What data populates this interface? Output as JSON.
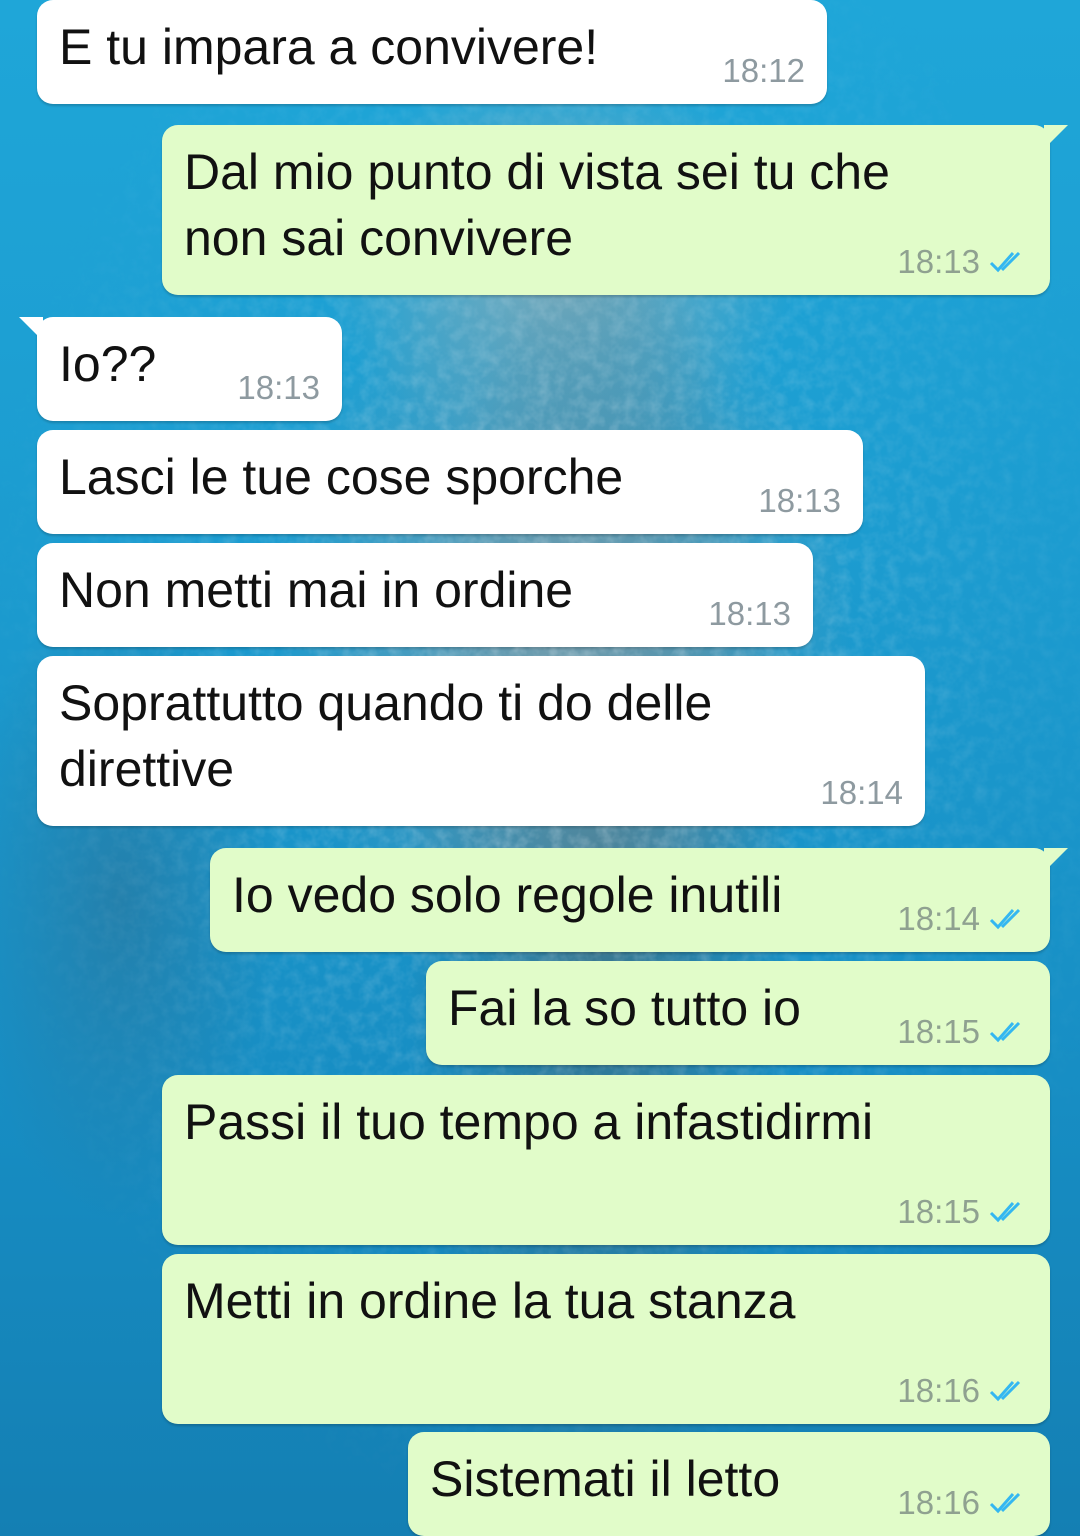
{
  "colors": {
    "incoming_bubble": "#ffffff",
    "outgoing_bubble": "#e1fcc9",
    "read_ticks": "#34b7f1",
    "wallpaper": "#1e9fcf"
  },
  "messages": [
    {
      "direction": "in",
      "text": "E tu impara a convivere!",
      "time": "18:12",
      "status": ""
    },
    {
      "direction": "out",
      "text": "Dal mio punto di vista sei tu che\nnon sai convivere",
      "time": "18:13",
      "status": "read"
    },
    {
      "direction": "in",
      "text": "Io??",
      "time": "18:13",
      "status": ""
    },
    {
      "direction": "in",
      "text": "Lasci le tue cose sporche",
      "time": "18:13",
      "status": ""
    },
    {
      "direction": "in",
      "text": "Non metti mai in ordine",
      "time": "18:13",
      "status": ""
    },
    {
      "direction": "in",
      "text": "Soprattutto quando ti do delle\ndirettive",
      "time": "18:14",
      "status": ""
    },
    {
      "direction": "out",
      "text": "Io vedo solo regole inutili",
      "time": "18:14",
      "status": "read"
    },
    {
      "direction": "out",
      "text": "Fai la so tutto io",
      "time": "18:15",
      "status": "read"
    },
    {
      "direction": "out",
      "text": "Passi il tuo tempo a infastidirmi",
      "time": "18:15",
      "status": "read"
    },
    {
      "direction": "out",
      "text": "Metti in ordine la tua stanza",
      "time": "18:16",
      "status": "read"
    },
    {
      "direction": "out",
      "text": "Sistemati il letto",
      "time": "18:16",
      "status": "read"
    }
  ]
}
